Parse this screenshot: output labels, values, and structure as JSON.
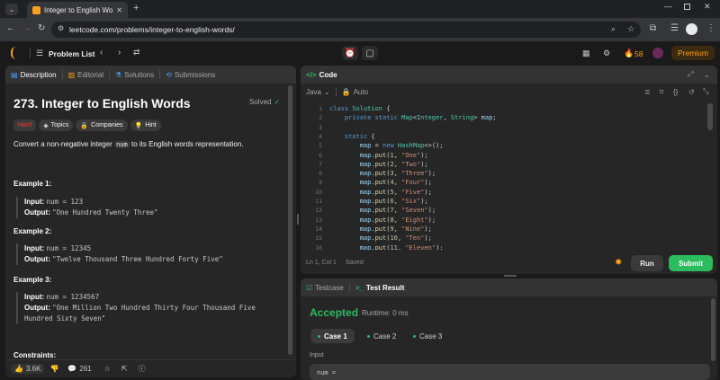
{
  "browser": {
    "tab_title": "Integer to English Words - Lee",
    "url": "leetcode.com/problems/integer-to-english-words/"
  },
  "nav": {
    "problem_list": "Problem List",
    "streak": "58",
    "premium": "Premium"
  },
  "left_panel": {
    "tabs": [
      {
        "label": "Description",
        "icon": "description-icon"
      },
      {
        "label": "Editorial",
        "icon": "book-icon"
      },
      {
        "label": "Solutions",
        "icon": "flask-icon"
      },
      {
        "label": "Submissions",
        "icon": "history-icon"
      }
    ],
    "title": "273. Integer to English Words",
    "solved": "Solved",
    "difficulty": "Hard",
    "tags": [
      "Topics",
      "Companies",
      "Hint"
    ],
    "statement_pre": "Convert a non-negative integer",
    "statement_code": "num",
    "statement_post": "to its English words representation.",
    "examples": [
      {
        "label": "Example 1:",
        "input_label": "Input:",
        "input": "num = 123",
        "output_label": "Output:",
        "output": "\"One Hundred Twenty Three\""
      },
      {
        "label": "Example 2:",
        "input_label": "Input:",
        "input": "num = 12345",
        "output_label": "Output:",
        "output": "\"Twelve Thousand Three Hundred Forty Five\""
      },
      {
        "label": "Example 3:",
        "input_label": "Input:",
        "input": "num = 1234567",
        "output_label": "Output:",
        "output": "\"One Million Two Hundred Thirty Four Thousand Five Hundred Sixty Seven\""
      }
    ],
    "constraints": "Constraints:",
    "footer": {
      "likes": "3.6K",
      "comments": "261"
    }
  },
  "code_panel": {
    "title": "Code",
    "language": "Java",
    "auto": "Auto",
    "status_pos": "Ln 1, Col 1",
    "status_saved": "Saved",
    "run": "Run",
    "submit": "Submit",
    "line_numbers": [
      "1",
      "2",
      "3",
      "4",
      "5",
      "6",
      "7",
      "8",
      "9",
      "10",
      "11",
      "12",
      "13",
      "14",
      "15",
      "16"
    ]
  },
  "result_panel": {
    "tabs": [
      "Testcase",
      "Test Result"
    ],
    "accepted": "Accepted",
    "runtime": "Runtime: 0 ms",
    "cases": [
      "Case 1",
      "Case 2",
      "Case 3"
    ],
    "input_label": "Input",
    "input_value": "num ="
  },
  "colors": {
    "accent": "#ffa116",
    "accepted": "#2cbb5d",
    "hard": "#f63636",
    "submit": "#2cbb5d"
  }
}
